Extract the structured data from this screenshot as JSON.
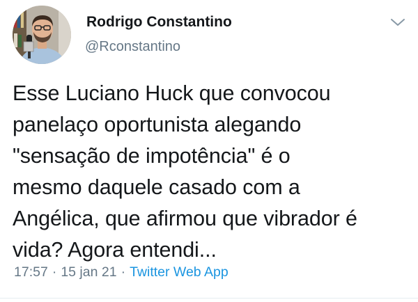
{
  "tweet": {
    "author": {
      "display_name": "Rodrigo Constantino",
      "handle": "@Rconstantino",
      "avatar_icon": "person-with-microphone-avatar"
    },
    "menu_icon": "chevron-down-icon",
    "text": "Esse Luciano Huck que convocou\npanelaço oportunista alegando\n\"sensação de impotência\" é o\nmesmo daquele casado com a\nAngélica, que afirmou que vibrador é\nvida? Agora entendi...",
    "time": "17:57",
    "date": "15 jan 21",
    "separator": "·",
    "source": "Twitter Web App"
  },
  "colors": {
    "text": "#14171a",
    "secondary": "#657786",
    "link": "#1b95e0"
  }
}
